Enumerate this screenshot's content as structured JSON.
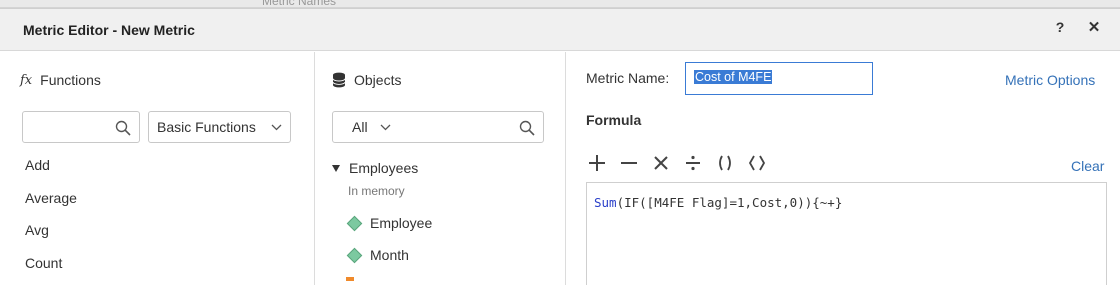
{
  "background": {
    "tab_text": "Metric Names"
  },
  "dialog": {
    "title": "Metric Editor - New Metric",
    "help_label": "?",
    "close_label": "✕"
  },
  "functions_panel": {
    "heading": "Functions",
    "heading_icon": "fx-icon",
    "search_placeholder": "",
    "category_selected": "Basic Functions",
    "items": [
      "Add",
      "Average",
      "Avg",
      "Count"
    ]
  },
  "objects_panel": {
    "heading": "Objects",
    "heading_icon": "database-icon",
    "filter_selected": "All",
    "search_placeholder": "",
    "folder": {
      "name": "Employees",
      "subtitle": "In memory",
      "items": [
        "Employee",
        "Month"
      ]
    }
  },
  "formula_panel": {
    "metric_name_label": "Metric Name:",
    "metric_name_value": "Cost of M4FE",
    "metric_options_link": "Metric Options",
    "formula_heading": "Formula",
    "clear_link": "Clear",
    "operators": [
      "plus-icon",
      "minus-icon",
      "multiply-icon",
      "divide-icon",
      "parentheses-icon",
      "angle-brackets-icon"
    ],
    "formula_function": "Sum",
    "formula_rest": "(IF([M4FE Flag]=1,Cost,0)){~+}"
  },
  "colors": {
    "accent_blue": "#3a7bd5",
    "link_blue": "#3572b8",
    "attribute_green": "#7cc9a0",
    "keyword_blue": "#2a3fc9",
    "titlebar_bg": "#f0f0f0"
  }
}
